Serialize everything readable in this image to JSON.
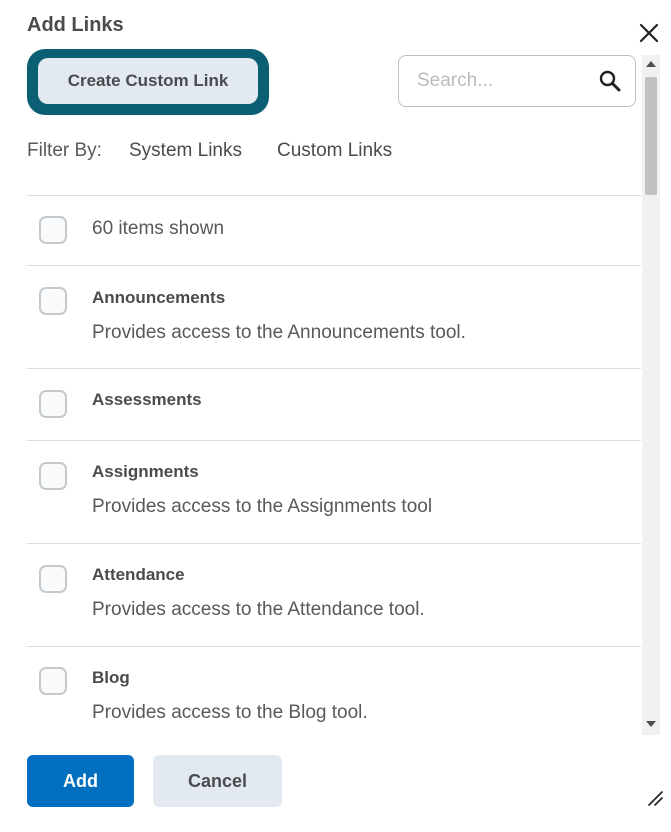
{
  "dialog": {
    "title": "Add Links",
    "close_icon": "close-icon"
  },
  "toolbar": {
    "create_label": "Create Custom Link",
    "highlight_color": "#0b5f73"
  },
  "search": {
    "placeholder": "Search...",
    "value": "",
    "icon": "search-icon"
  },
  "filter": {
    "label": "Filter By:",
    "options": [
      "System Links",
      "Custom Links"
    ]
  },
  "list": {
    "count_text": "60 items shown",
    "items": [
      {
        "title": "Announcements",
        "description": "Provides access to the Announcements tool."
      },
      {
        "title": "Assessments",
        "description": ""
      },
      {
        "title": "Assignments",
        "description": "Provides access to the Assignments tool"
      },
      {
        "title": "Attendance",
        "description": "Provides access to the Attendance tool."
      },
      {
        "title": "Blog",
        "description": "Provides access to the Blog tool."
      }
    ]
  },
  "footer": {
    "add_label": "Add",
    "cancel_label": "Cancel",
    "primary_color": "#006fbf"
  }
}
